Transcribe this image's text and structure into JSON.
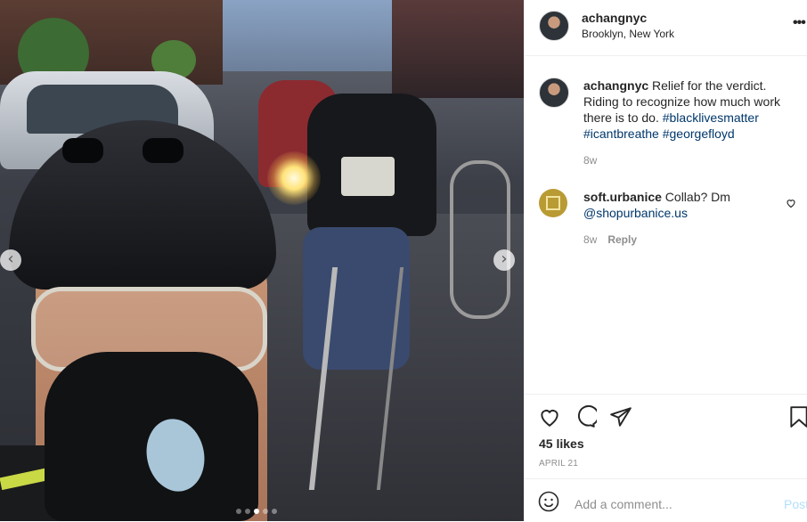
{
  "post": {
    "username": "achangnyc",
    "location": "Brooklyn, New York",
    "more_label": "•••"
  },
  "caption": {
    "username": "achangnyc",
    "text": "Relief for the verdict. Riding to recognize how much work there is to do.",
    "hashtags": [
      "#blacklivesmatter",
      "#icantbreathe",
      "#georgefloyd"
    ],
    "age": "8w"
  },
  "reply": {
    "username": "soft.urbanice",
    "text": "Collab? Dm",
    "mention": "@shopurbanice.us",
    "age": "8w",
    "reply_label": "Reply"
  },
  "stats": {
    "likes": "45 likes",
    "date": "APRIL 21"
  },
  "composer": {
    "placeholder": "Add a comment...",
    "post_label": "Post"
  },
  "carousel": {
    "prev_label": "‹",
    "next_label": "›",
    "slide_count": 5,
    "active_slide": 3
  },
  "colors": {
    "link": "#00376b",
    "muted": "#8e8e8e",
    "post_disabled": "#b2dffc"
  },
  "icons": [
    "more-icon",
    "heart-icon",
    "comment-icon",
    "share-icon",
    "bookmark-icon",
    "emoji-icon",
    "like-comment-icon",
    "chevron-left-icon",
    "chevron-right-icon"
  ]
}
